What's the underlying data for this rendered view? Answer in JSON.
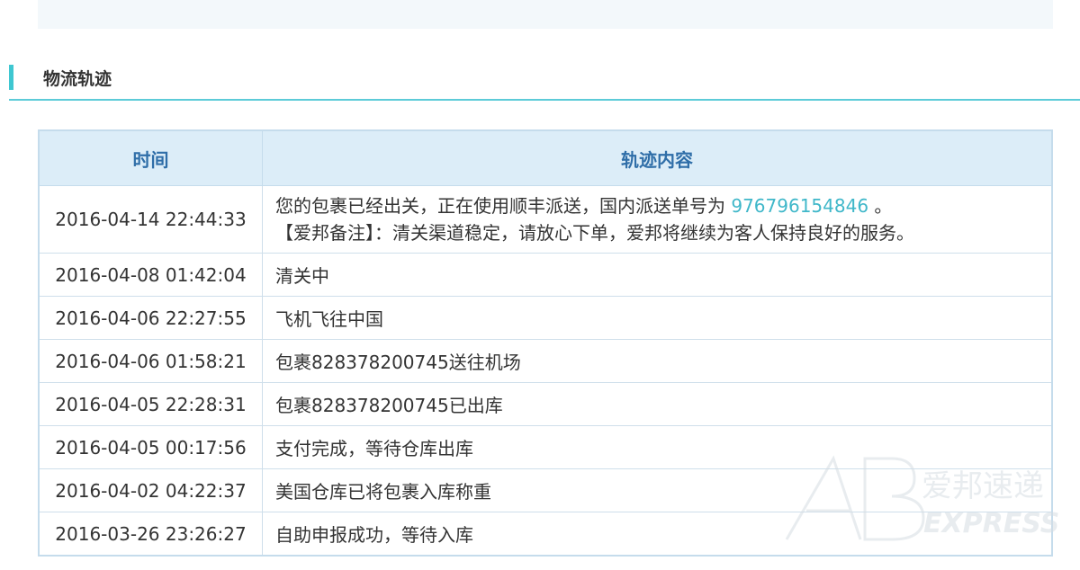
{
  "section": {
    "title": "物流轨迹"
  },
  "table": {
    "headers": {
      "time": "时间",
      "content": "轨迹内容"
    },
    "first_row": {
      "time": "2016-04-14 22:44:33",
      "line1_prefix": "您的包裹已经出关，正在使用顺丰派送，国内派送单号为 ",
      "tracking_number": "976796154846",
      "line1_suffix": " 。",
      "line2": "【爱邦备注】：清关渠道稳定，请放心下单，爱邦将继续为客人保持良好的服务。"
    },
    "rows": [
      {
        "time": "2016-04-08 01:42:04",
        "content": "清关中"
      },
      {
        "time": "2016-04-06 22:27:55",
        "content": "飞机飞往中国"
      },
      {
        "time": "2016-04-06 01:58:21",
        "content": "包裹828378200745送往机场"
      },
      {
        "time": "2016-04-05 22:28:31",
        "content": "包裹828378200745已出库"
      },
      {
        "time": "2016-04-05 00:17:56",
        "content": "支付完成，等待仓库出库"
      },
      {
        "time": "2016-04-02 04:22:37",
        "content": "美国仓库已将包裹入库称重"
      },
      {
        "time": "2016-03-26 23:26:27",
        "content": "自助申报成功，等待入库"
      }
    ]
  },
  "watermark": {
    "brand_cn": "爱邦速递",
    "brand_en": "EXPRESS",
    "logo": "AB"
  },
  "colors": {
    "accent": "#3fc7d1",
    "header_bg": "#dcedf8",
    "header_text": "#2f6ea8",
    "link": "#3fb7c9"
  }
}
